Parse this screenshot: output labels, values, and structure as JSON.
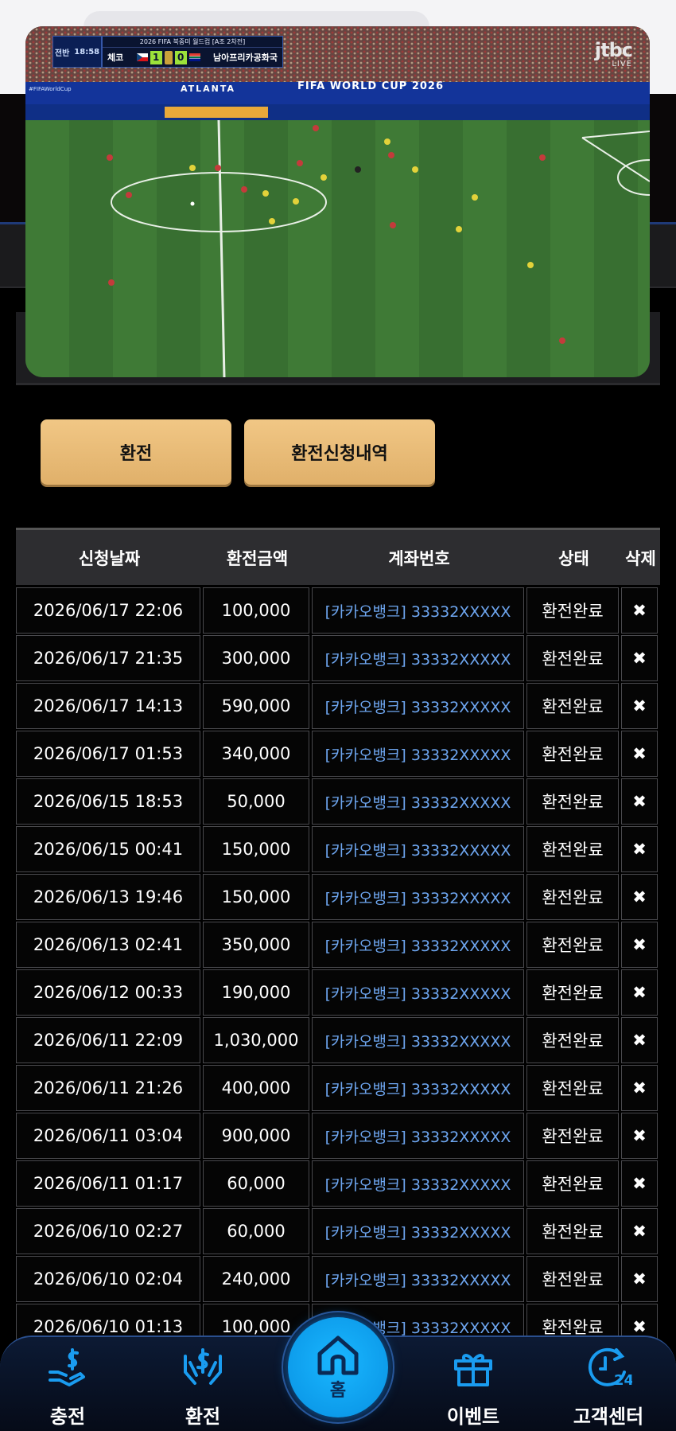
{
  "video": {
    "match_title": "2026 FIFA 북중미 월드컵 [A조 2차전]",
    "half": "전반",
    "clock": "18:58",
    "home_team": "체코",
    "away_team": "남아프리카공화국",
    "home_score": "1",
    "away_score": "0",
    "broadcaster": "jtbc",
    "live_label": "LIVE",
    "banner": "FIFA WORLD CUP 2026",
    "venue": "ATLANTA",
    "hashtag": "#FIFAWorldCup"
  },
  "actions": {
    "exchange_label": "환전",
    "history_label": "환전신청내역"
  },
  "table": {
    "headers": [
      "신청날짜",
      "환전금액",
      "계좌번호",
      "상태",
      "삭제"
    ],
    "delete_glyph": "✖",
    "rows": [
      {
        "date": "2026/06/17 22:06",
        "amount": "100,000",
        "account": "[카카오뱅크] 33332XXXXX",
        "status": "환전완료"
      },
      {
        "date": "2026/06/17 21:35",
        "amount": "300,000",
        "account": "[카카오뱅크] 33332XXXXX",
        "status": "환전완료"
      },
      {
        "date": "2026/06/17 14:13",
        "amount": "590,000",
        "account": "[카카오뱅크] 33332XXXXX",
        "status": "환전완료"
      },
      {
        "date": "2026/06/17 01:53",
        "amount": "340,000",
        "account": "[카카오뱅크] 33332XXXXX",
        "status": "환전완료"
      },
      {
        "date": "2026/06/15 18:53",
        "amount": "50,000",
        "account": "[카카오뱅크] 33332XXXXX",
        "status": "환전완료"
      },
      {
        "date": "2026/06/15 00:41",
        "amount": "150,000",
        "account": "[카카오뱅크] 33332XXXXX",
        "status": "환전완료"
      },
      {
        "date": "2026/06/13 19:46",
        "amount": "150,000",
        "account": "[카카오뱅크] 33332XXXXX",
        "status": "환전완료"
      },
      {
        "date": "2026/06/13 02:41",
        "amount": "350,000",
        "account": "[카카오뱅크] 33332XXXXX",
        "status": "환전완료"
      },
      {
        "date": "2026/06/12 00:33",
        "amount": "190,000",
        "account": "[카카오뱅크] 33332XXXXX",
        "status": "환전완료"
      },
      {
        "date": "2026/06/11 22:09",
        "amount": "1,030,000",
        "account": "[카카오뱅크] 33332XXXXX",
        "status": "환전완료"
      },
      {
        "date": "2026/06/11 21:26",
        "amount": "400,000",
        "account": "[카카오뱅크] 33332XXXXX",
        "status": "환전완료"
      },
      {
        "date": "2026/06/11 03:04",
        "amount": "900,000",
        "account": "[카카오뱅크] 33332XXXXX",
        "status": "환전완료"
      },
      {
        "date": "2026/06/11 01:17",
        "amount": "60,000",
        "account": "[카카오뱅크] 33332XXXXX",
        "status": "환전완료"
      },
      {
        "date": "2026/06/10 02:27",
        "amount": "60,000",
        "account": "[카카오뱅크] 33332XXXXX",
        "status": "환전완료"
      },
      {
        "date": "2026/06/10 02:04",
        "amount": "240,000",
        "account": "[카카오뱅크] 33332XXXXX",
        "status": "환전완료"
      },
      {
        "date": "2026/06/10 01:13",
        "amount": "100,000",
        "account": "[카카오뱅크] 33332XXXXX",
        "status": "환전완료"
      }
    ]
  },
  "nav": {
    "charge": "충전",
    "exchange": "환전",
    "home": "홈",
    "event": "이벤트",
    "support": "고객센터",
    "support_badge": "24"
  },
  "colors": {
    "button_gold": "#e7b977",
    "account_link": "#6ea6f0",
    "nav_icon": "#1a9cf0",
    "home_button": "#0a9af0"
  }
}
